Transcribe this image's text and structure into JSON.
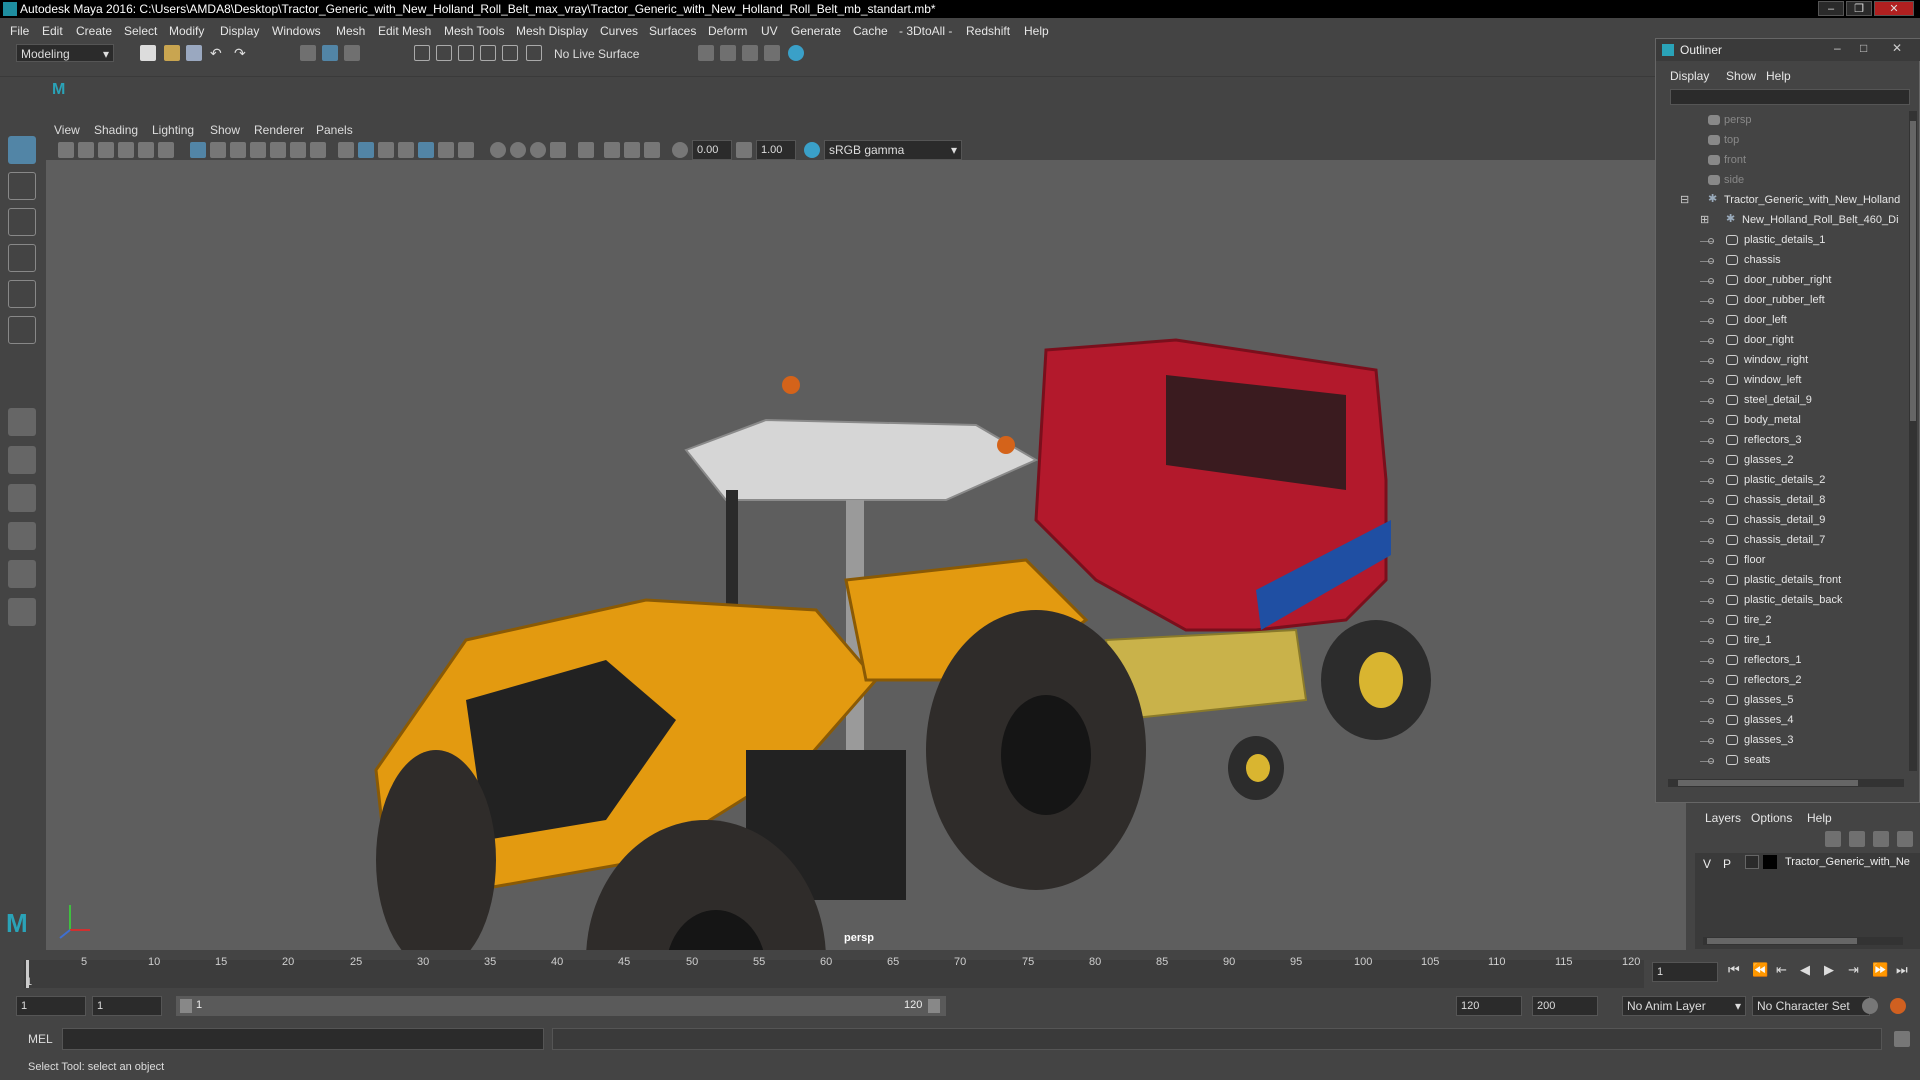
{
  "window": {
    "title": "Autodesk Maya 2016: C:\\Users\\AMDA8\\Desktop\\Tractor_Generic_with_New_Holland_Roll_Belt_max_vray\\Tractor_Generic_with_New_Holland_Roll_Belt_mb_standart.mb*",
    "minimize": "‒",
    "maximize": "❐",
    "close": "✕"
  },
  "menubar": [
    "File",
    "Edit",
    "Create",
    "Select",
    "Modify",
    "Display",
    "Windows",
    "Mesh",
    "Edit Mesh",
    "Mesh Tools",
    "Mesh Display",
    "Curves",
    "Surfaces",
    "Deform",
    "UV",
    "Generate",
    "Cache",
    "- 3DtoAll -",
    "Redshift",
    "Help"
  ],
  "toolbar": {
    "mode": "Modeling",
    "live_surface": "No Live Surface"
  },
  "viewport": {
    "menu": [
      "View",
      "Shading",
      "Lighting",
      "Show",
      "Renderer",
      "Panels"
    ],
    "exposure": "0.00",
    "gamma": "1.00",
    "color_space": "sRGB gamma",
    "camera_label": "persp"
  },
  "outliner": {
    "title": "Outliner",
    "menu": [
      "Display",
      "Show",
      "Help"
    ],
    "cameras": [
      "persp",
      "top",
      "front",
      "side"
    ],
    "root": "Tractor_Generic_with_New_Holland",
    "group": "New_Holland_Roll_Belt_460_Di",
    "meshes": [
      "plastic_details_1",
      "chassis",
      "door_rubber_right",
      "door_rubber_left",
      "door_left",
      "door_right",
      "window_right",
      "window_left",
      "steel_detail_9",
      "body_metal",
      "reflectors_3",
      "glasses_2",
      "plastic_details_2",
      "chassis_detail_8",
      "chassis_detail_9",
      "chassis_detail_7",
      "floor",
      "plastic_details_front",
      "plastic_details_back",
      "tire_2",
      "tire_1",
      "reflectors_1",
      "reflectors_2",
      "glasses_5",
      "glasses_4",
      "glasses_3",
      "seats"
    ]
  },
  "layers": {
    "menu": [
      "Layers",
      "Options",
      "Help"
    ],
    "row": {
      "v": "V",
      "p": "P",
      "name": "Tractor_Generic_with_Ne"
    }
  },
  "timeline": {
    "ticks": [
      "1",
      "5",
      "10",
      "15",
      "20",
      "25",
      "30",
      "35",
      "40",
      "45",
      "50",
      "55",
      "60",
      "65",
      "70",
      "75",
      "80",
      "85",
      "90",
      "95",
      "100",
      "105",
      "110",
      "115",
      "120"
    ],
    "current_frame": "1"
  },
  "range": {
    "start": "1",
    "playback_start": "1",
    "slider_start": "1",
    "slider_end": "120",
    "playback_end": "120",
    "end": "200",
    "anim_layer": "No Anim Layer",
    "character_set": "No Character Set"
  },
  "command": {
    "label": "MEL"
  },
  "help_line": "Select Tool: select an object",
  "colors": {
    "accent": "#5285a6",
    "tractor_orange": "#e39a10",
    "baler_red": "#b3192c",
    "baler_blue": "#1f4fa3",
    "viewport_bg": "#5e5e5e"
  }
}
